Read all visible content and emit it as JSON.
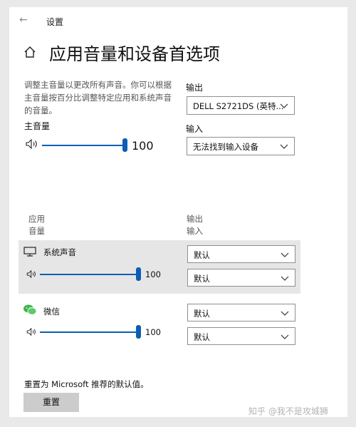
{
  "window": {
    "title": "设置",
    "back_glyph": "←"
  },
  "page": {
    "title": "应用音量和设备首选项",
    "description": "调整主音量以更改所有声音。你可以根据主音量按百分比调整特定应用和系统声音的音量。"
  },
  "master": {
    "label": "主音量",
    "value": "100",
    "level": 100
  },
  "output": {
    "label": "输出",
    "selected": "DELL S2721DS (英特..."
  },
  "input": {
    "label": "输入",
    "selected": "无法找到输入设备"
  },
  "columns": {
    "app": "应用",
    "volume": "音量",
    "output": "输出",
    "input": "输入"
  },
  "apps": [
    {
      "name": "系统声音",
      "value": "100",
      "level": 100,
      "output": "默认",
      "input": "默认",
      "icon": "monitor-icon"
    },
    {
      "name": "微信",
      "value": "100",
      "level": 100,
      "output": "默认",
      "input": "默认",
      "icon": "wechat-icon"
    }
  ],
  "footer": {
    "reset_text": "重置为 Microsoft 推荐的默认值。",
    "reset_button": "重置"
  },
  "watermark": "知乎 @我不是攻城狮",
  "colors": {
    "accent": "#0a5fb4",
    "highlight_row": "#e6e6e6",
    "button": "#cccccc"
  }
}
